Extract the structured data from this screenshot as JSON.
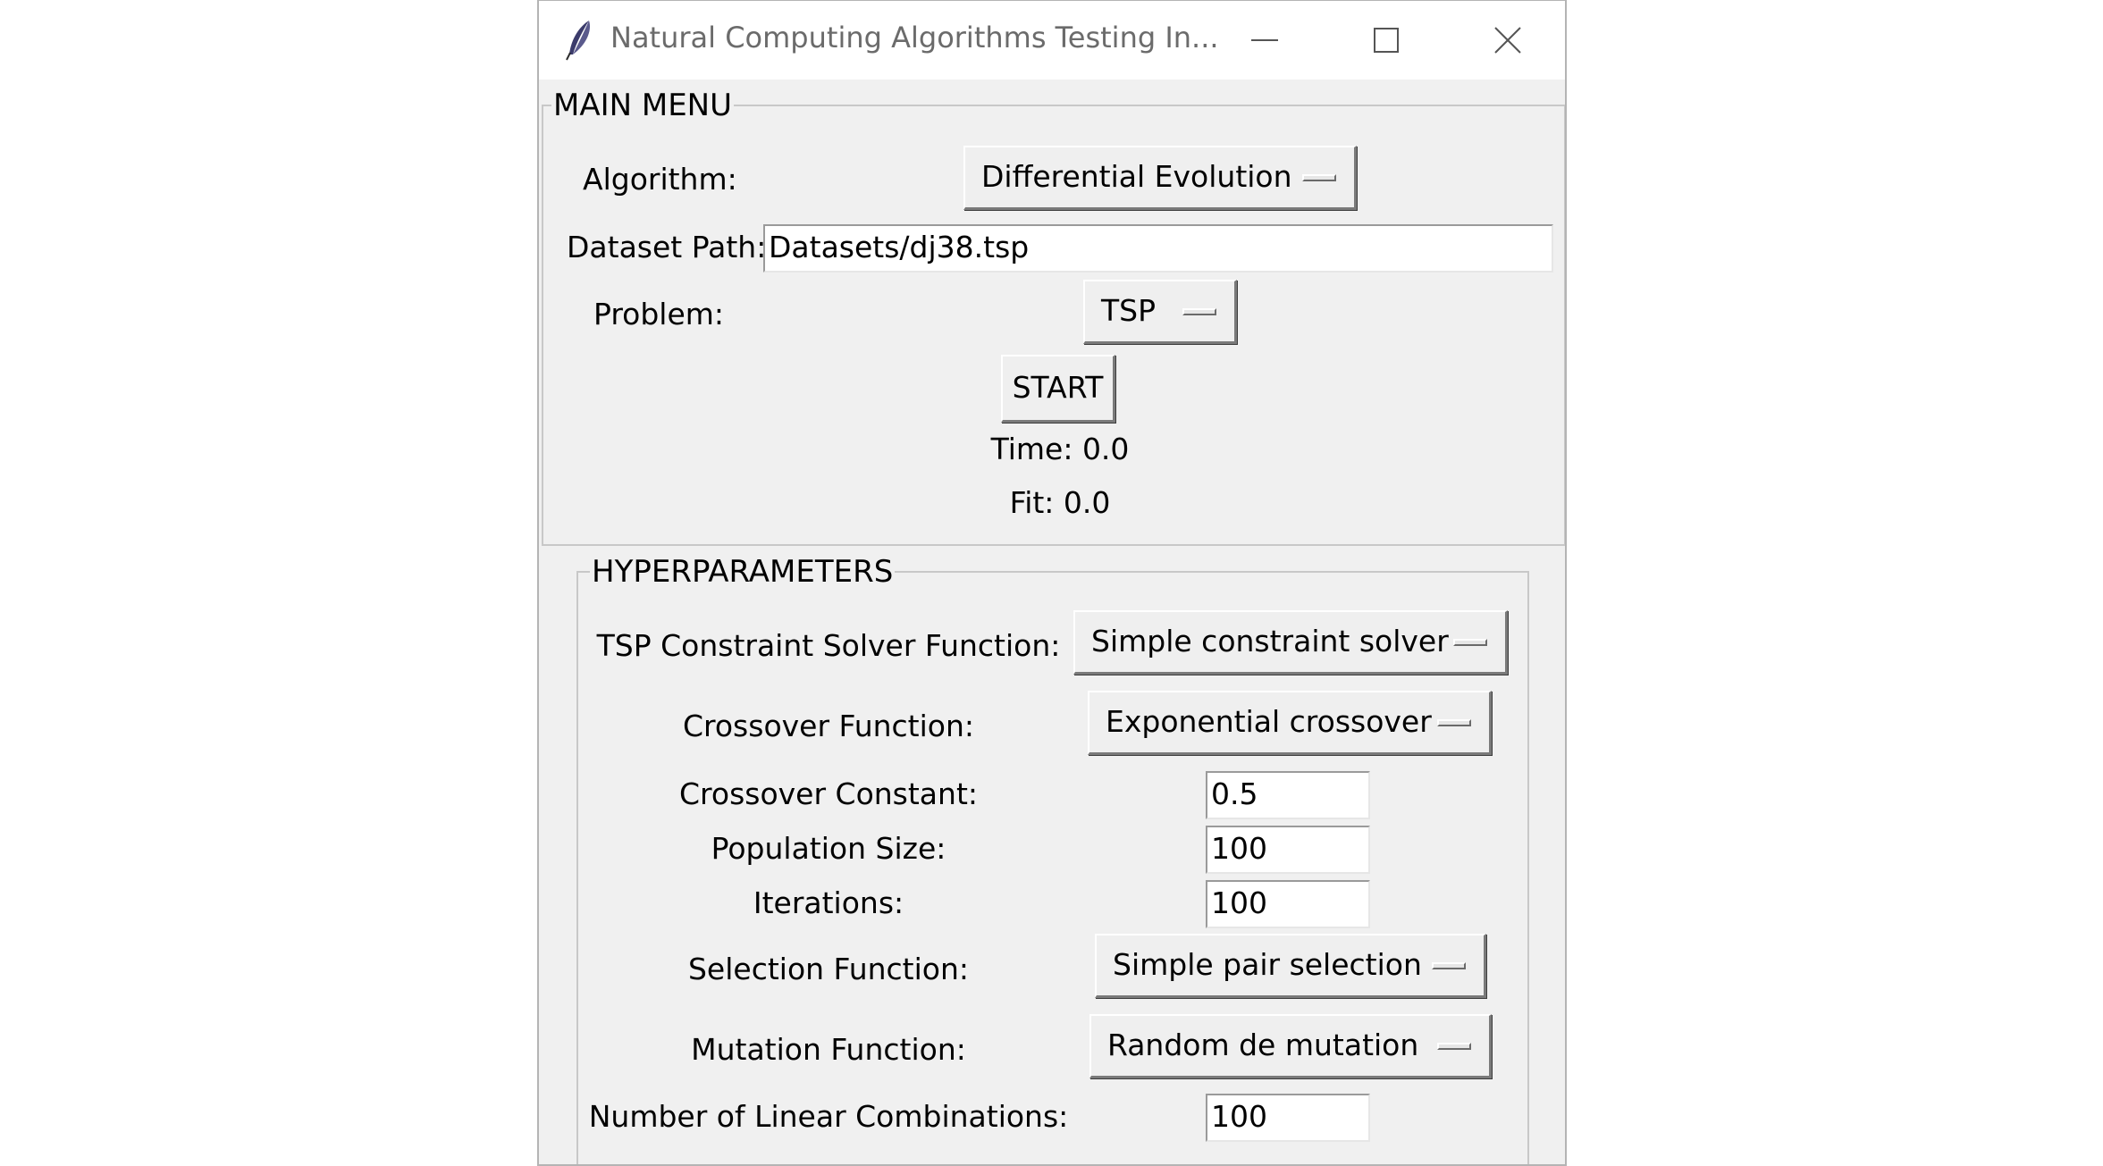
{
  "window": {
    "title": "Natural Computing Algorithms Testing In...",
    "icon": "feather-icon"
  },
  "main_menu": {
    "legend": "MAIN MENU",
    "algorithm_label": "Algorithm:",
    "algorithm_value": "Differential Evolution",
    "dataset_label": "Dataset Path:",
    "dataset_value": "Datasets/dj38.tsp",
    "problem_label": "Problem:",
    "problem_value": "TSP",
    "start_label": "START",
    "time_text": "Time: 0.0",
    "fit_text": "Fit: 0.0"
  },
  "hyperparameters": {
    "legend": "HYPERPARAMETERS",
    "tsp_solver_label": "TSP Constraint Solver Function:",
    "tsp_solver_value": "Simple constraint solver",
    "crossover_label": "Crossover Function:",
    "crossover_value": "Exponential crossover",
    "crossover_const_label": "Crossover Constant:",
    "crossover_const_value": "0.5",
    "population_label": "Population Size:",
    "population_value": "100",
    "iterations_label": "Iterations:",
    "iterations_value": "100",
    "selection_label": "Selection Function:",
    "selection_value": "Simple pair selection",
    "mutation_label": "Mutation Function:",
    "mutation_value": "Random de mutation",
    "linear_comb_label": "Number of Linear Combinations:",
    "linear_comb_value": "100"
  },
  "colors": {
    "window_bg": "#f0f0f0",
    "titlebar_bg": "#ffffff",
    "title_text": "#6b6b6b",
    "groove": "#c8c8c8"
  }
}
